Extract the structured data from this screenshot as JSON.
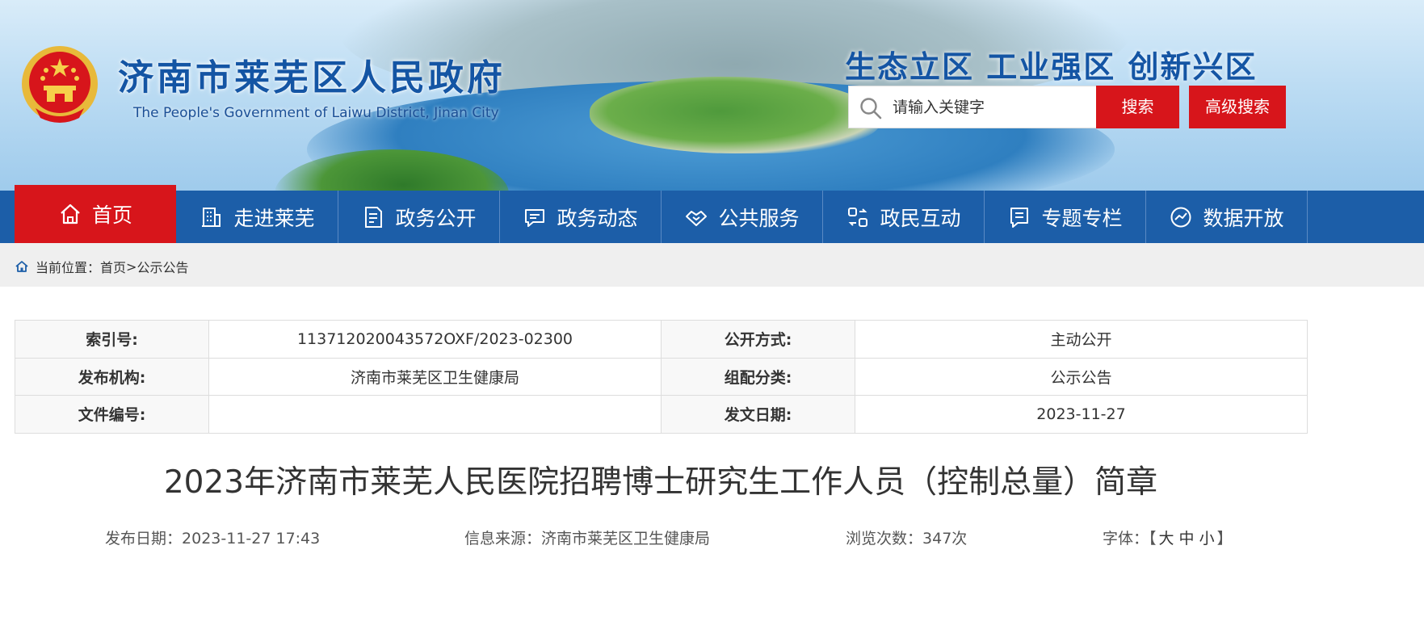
{
  "header": {
    "title": "济南市莱芜区人民政府",
    "subtitle": "The People's Government of Laiwu District, Jinan City",
    "slogan": "生态立区  工业强区  创新兴区",
    "search_placeholder": "请输入关键字",
    "search_button": "搜索",
    "advanced_search_button": "高级搜索"
  },
  "nav": {
    "items": [
      {
        "label": "首页",
        "icon": "home-icon"
      },
      {
        "label": "走进莱芜",
        "icon": "building-icon"
      },
      {
        "label": "政务公开",
        "icon": "document-icon"
      },
      {
        "label": "政务动态",
        "icon": "chat-icon"
      },
      {
        "label": "公共服务",
        "icon": "handshake-icon"
      },
      {
        "label": "政民互动",
        "icon": "interaction-icon"
      },
      {
        "label": "专题专栏",
        "icon": "topic-icon"
      },
      {
        "label": "数据开放",
        "icon": "chart-icon"
      }
    ],
    "active_index": 0
  },
  "breadcrumb": {
    "prefix": "当前位置：",
    "home": "首页",
    "separator": ">",
    "current": "公示公告"
  },
  "info_table": {
    "rows": [
      {
        "k1": "索引号:",
        "v1": "113712020043572OXF/2023-02300",
        "k2": "公开方式:",
        "v2": "主动公开"
      },
      {
        "k1": "发布机构:",
        "v1": "济南市莱芜区卫生健康局",
        "k2": "组配分类:",
        "v2": "公示公告"
      },
      {
        "k1": "文件编号:",
        "v1": "",
        "k2": "发文日期:",
        "v2": "2023-11-27"
      }
    ]
  },
  "article": {
    "title": "2023年济南市莱芜人民医院招聘博士研究生工作人员（控制总量）简章",
    "publish_date_label": "发布日期：",
    "publish_date": "2023-11-27 17:43",
    "source_label": "信息来源：",
    "source": "济南市莱芜区卫生健康局",
    "views_label": "浏览次数：",
    "views": "347次",
    "font_label": "字体：",
    "font_open": "【",
    "font_large": "大",
    "font_medium": "中",
    "font_small": "小",
    "font_close": "】"
  },
  "colors": {
    "brand_blue": "#1c5ea8",
    "accent_red": "#d7151b"
  }
}
